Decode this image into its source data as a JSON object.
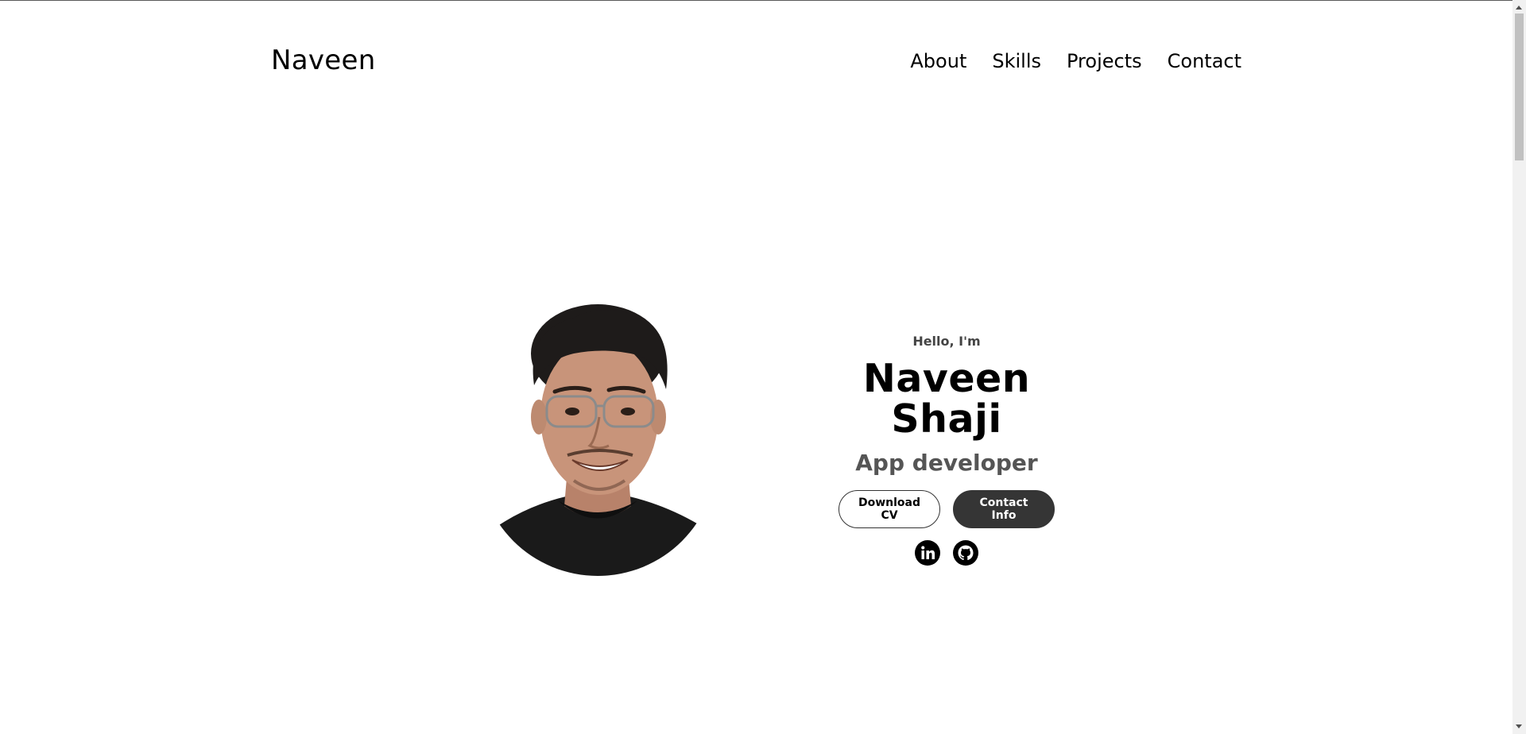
{
  "header": {
    "logo": "Naveen",
    "nav": [
      {
        "label": "About"
      },
      {
        "label": "Skills"
      },
      {
        "label": "Projects"
      },
      {
        "label": "Contact"
      }
    ]
  },
  "hero": {
    "greeting": "Hello, I'm",
    "name": "Naveen Shaji",
    "role": "App developer",
    "buttons": {
      "download": "Download CV",
      "contact": "Contact Info"
    },
    "socials": [
      "linkedin-icon",
      "github-icon"
    ]
  },
  "colors": {
    "solid_button": "#353535",
    "role_text": "#555555",
    "shirt": "#1a1a1a",
    "skin": "#c8947a",
    "hair": "#1e1b1a"
  }
}
